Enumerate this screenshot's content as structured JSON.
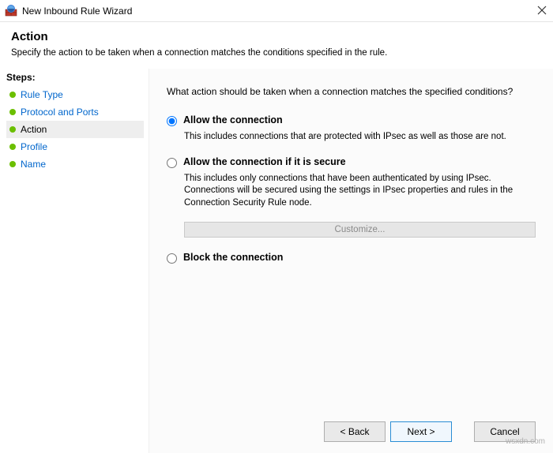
{
  "window": {
    "title": "New Inbound Rule Wizard"
  },
  "header": {
    "title": "Action",
    "subtitle": "Specify the action to be taken when a connection matches the conditions specified in the rule."
  },
  "sidebar": {
    "label": "Steps:",
    "items": [
      {
        "label": "Rule Type",
        "state": "link"
      },
      {
        "label": "Protocol and Ports",
        "state": "link"
      },
      {
        "label": "Action",
        "state": "current"
      },
      {
        "label": "Profile",
        "state": "link"
      },
      {
        "label": "Name",
        "state": "link"
      }
    ]
  },
  "content": {
    "prompt": "What action should be taken when a connection matches the specified conditions?",
    "options": {
      "allow": {
        "label": "Allow the connection",
        "desc": "This includes connections that are protected with IPsec as well as those are not."
      },
      "allow_secure": {
        "label": "Allow the connection if it is secure",
        "desc": "This includes only connections that have been authenticated by using IPsec.  Connections will be secured using the settings in IPsec properties and rules in the Connection Security Rule node.",
        "customize": "Customize..."
      },
      "block": {
        "label": "Block the connection"
      }
    }
  },
  "buttons": {
    "back": "< Back",
    "next": "Next >",
    "cancel": "Cancel"
  },
  "watermark": "wsxdn.com"
}
